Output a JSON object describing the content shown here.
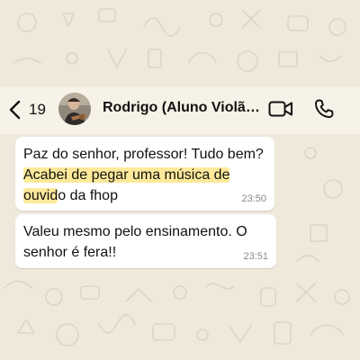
{
  "colors": {
    "background": "#efe9dc",
    "header": "#f6f2e7",
    "bubble": "#ffffff",
    "highlight": "#fde99a",
    "timestamp": "#8a8a8a"
  },
  "header": {
    "back_icon": "chevron-left-icon",
    "unread_count": "19",
    "contact_name": "Rodrigo (Aluno Violão",
    "video_icon": "video-camera-icon",
    "phone_icon": "phone-icon"
  },
  "messages": [
    {
      "parts": [
        {
          "text": "Paz do senhor, professor! Tudo bem? ",
          "highlighted": false
        },
        {
          "text": "Acabei de pegar uma música de ouvid",
          "highlighted": true
        },
        {
          "text": "o da fhop",
          "highlighted": false
        }
      ],
      "time": "23:50"
    },
    {
      "parts": [
        {
          "text": "Valeu mesmo pelo ensinamento. O senhor é fera!!",
          "highlighted": false
        }
      ],
      "time": "23:51"
    }
  ]
}
